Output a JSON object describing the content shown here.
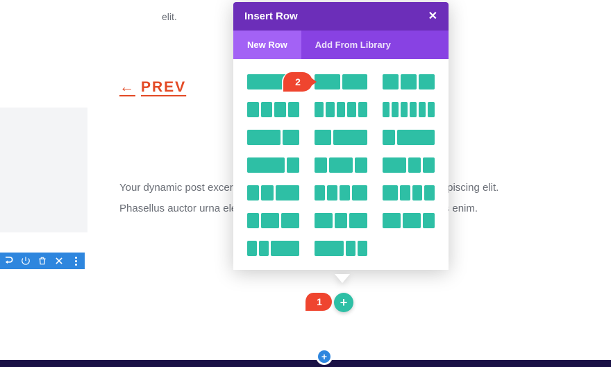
{
  "fragment_text": "elit.",
  "prev_link": {
    "arrow": "←",
    "label": "PREV"
  },
  "excerpt": {
    "line1_left": "Your dynamic post excerpt ",
    "line1_right": "etur adipiscing elit.",
    "line2_left": "Phasellus auctor urna eleife",
    "line2_right": "r lectus enim."
  },
  "modal": {
    "title": "Insert Row",
    "tabs": {
      "new_row": "New Row",
      "library": "Add From Library"
    }
  },
  "badges": {
    "one": "1",
    "two": "2"
  },
  "buttons": {
    "plus": "+"
  }
}
